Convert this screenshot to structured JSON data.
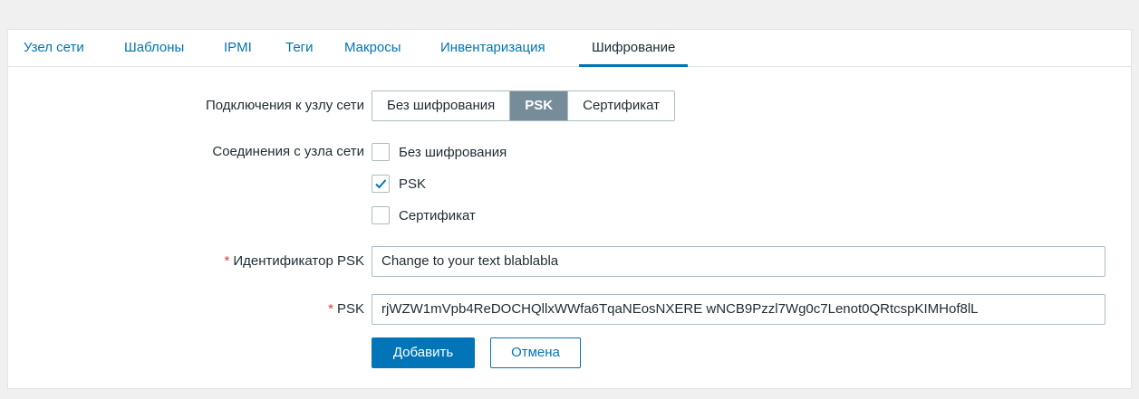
{
  "tabs": [
    {
      "label": "Узел сети"
    },
    {
      "label": "Шаблоны"
    },
    {
      "label": "IPMI"
    },
    {
      "label": "Теги"
    },
    {
      "label": "Макросы"
    },
    {
      "label": "Инвентаризация"
    },
    {
      "label": "Шифрование",
      "active": true
    }
  ],
  "form": {
    "connections_to_host": {
      "label": "Подключения к узлу сети",
      "options": [
        "Без шифрования",
        "PSK",
        "Сертификат"
      ],
      "selected": "PSK"
    },
    "connections_from_host": {
      "label": "Соединения с узла сети",
      "options": [
        {
          "label": "Без шифрования",
          "checked": false
        },
        {
          "label": "PSK",
          "checked": true
        },
        {
          "label": "Сертификат",
          "checked": false
        }
      ]
    },
    "psk_identity": {
      "required_mark": "*",
      "label": "Идентификатор PSK",
      "value": "Change to your text blablabla"
    },
    "psk": {
      "required_mark": "*",
      "label": "PSK",
      "value": "rjWZW1mVpb4ReDOCHQllxWWfa6TqaNEosNXERE wNCB9Pzzl7Wg0c7Lenot0QRtcspKIMHof8lL"
    },
    "add_button": "Добавить",
    "cancel_button": "Отмена"
  },
  "colors": {
    "accent": "#0275b8",
    "segment_active": "#768d99",
    "required": "#e33734"
  }
}
